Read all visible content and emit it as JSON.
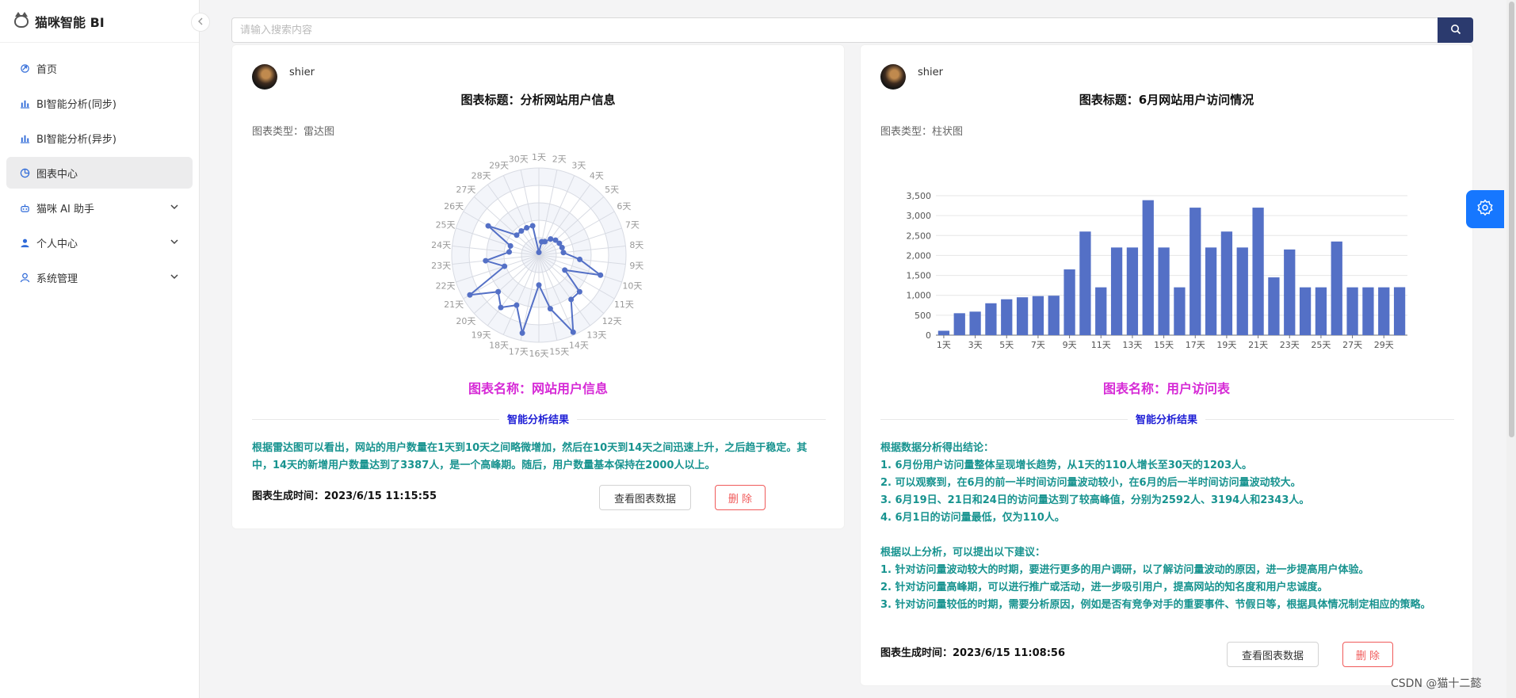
{
  "app": {
    "title": "猫咪智能 BI",
    "collapse_icon": "chevron-left-icon"
  },
  "sidebar": {
    "items": [
      {
        "label": "首页",
        "icon": "home-icon",
        "active": false,
        "has_children": false
      },
      {
        "label": "BI智能分析(同步)",
        "icon": "bar-chart-icon",
        "active": false,
        "has_children": false
      },
      {
        "label": "BI智能分析(异步)",
        "icon": "bar-chart-icon",
        "active": false,
        "has_children": false
      },
      {
        "label": "图表中心",
        "icon": "pie-chart-icon",
        "active": true,
        "has_children": false
      },
      {
        "label": "猫咪 AI 助手",
        "icon": "robot-icon",
        "active": false,
        "has_children": true
      },
      {
        "label": "个人中心",
        "icon": "user-icon",
        "active": false,
        "has_children": true
      },
      {
        "label": "系统管理",
        "icon": "team-icon",
        "active": false,
        "has_children": true
      }
    ]
  },
  "search": {
    "placeholder": "请输入搜索内容",
    "value": "",
    "button_icon": "search-icon"
  },
  "cards": [
    {
      "user": "shier",
      "title": "图表标题：分析网站用户信息",
      "type": "图表类型：雷达图",
      "name": "图表名称：网站用户信息",
      "divider_label": "智能分析结果",
      "analysis": [
        "根据雷达图可以看出，网站的用户数量在1天到10天之间略微增加，然后在10天到14天之间迅速上升，之后趋于稳定。其中，14天的新增用户数量达到了3387人，是一个高峰期。随后，用户数量基本保持在2000人以上。"
      ],
      "gen_time": "图表生成时间：2023/6/15 11:15:55",
      "view_label": "查看图表数据",
      "delete_label": "删 除"
    },
    {
      "user": "shier",
      "title": "图表标题：6月网站用户访问情况",
      "type": "图表类型：柱状图",
      "name": "图表名称：用户访问表",
      "divider_label": "智能分析结果",
      "analysis": [
        "根据数据分析得出结论：",
        "1. 6月份用户访问量整体呈现增长趋势，从1天的110人增长至30天的1203人。",
        "2. 可以观察到，在6月的前一半时间访问量波动较小，在6月的后一半时间访问量波动较大。",
        "3. 6月19日、21日和24日的访问量达到了较高峰值，分别为2592人、3194人和2343人。",
        "4. 6月1日的访问量最低，仅为110人。",
        "",
        "根据以上分析，可以提出以下建议：",
        "1. 针对访问量波动较大的时期，要进行更多的用户调研，以了解访问量波动的原因，进一步提高用户体验。",
        "2. 针对访问量高峰期，可以进行推广或活动，进一步吸引用户，提高网站的知名度和用户忠诚度。",
        "3. 针对访问量较低的时期，需要分析原因，例如是否有竞争对手的重要事件、节假日等，根据具体情况制定相应的策略。"
      ],
      "gen_time": "图表生成时间：2023/6/15 11:08:56",
      "view_label": "查看图表数据",
      "delete_label": "删 除"
    }
  ],
  "chart_data": [
    {
      "type": "radar",
      "categories": [
        "1天",
        "2天",
        "3天",
        "4天",
        "5天",
        "6天",
        "7天",
        "8天",
        "9天",
        "10天",
        "11天",
        "12天",
        "13天",
        "14天",
        "15天",
        "16天",
        "17天",
        "18天",
        "19天",
        "20天",
        "21天",
        "22天",
        "23天",
        "24天",
        "25天",
        "26天",
        "27天",
        "28天",
        "29天",
        "30天"
      ],
      "values": [
        110,
        550,
        590,
        800,
        900,
        950,
        980,
        990,
        1650,
        2600,
        1200,
        2200,
        2200,
        3387,
        2200,
        1200,
        3200,
        2200,
        2600,
        2200,
        3200,
        1450,
        2150,
        1200,
        1200,
        2350,
        1200,
        1200,
        1200,
        1203
      ],
      "max": 3500,
      "color": "#5470c6"
    },
    {
      "type": "bar",
      "categories": [
        "1天",
        "2天",
        "3天",
        "4天",
        "5天",
        "6天",
        "7天",
        "8天",
        "9天",
        "10天",
        "11天",
        "12天",
        "13天",
        "14天",
        "15天",
        "16天",
        "17天",
        "18天",
        "19天",
        "20天",
        "21天",
        "22天",
        "23天",
        "24天",
        "25天",
        "26天",
        "27天",
        "28天",
        "29天",
        "30天"
      ],
      "x_tick_labels": [
        "1天",
        "3天",
        "5天",
        "7天",
        "9天",
        "11天",
        "13天",
        "15天",
        "17天",
        "19天",
        "21天",
        "23天",
        "25天",
        "27天",
        "29天"
      ],
      "values": [
        110,
        550,
        590,
        800,
        900,
        950,
        980,
        990,
        1650,
        2600,
        1200,
        2200,
        2200,
        3387,
        2200,
        1200,
        3200,
        2200,
        2600,
        2200,
        3200,
        1450,
        2150,
        1200,
        1200,
        2350,
        1200,
        1200,
        1200,
        1203
      ],
      "ylim": [
        0,
        3500
      ],
      "y_ticks": [
        "0",
        "500",
        "1,000",
        "1,500",
        "2,000",
        "2,500",
        "3,000",
        "3,500"
      ],
      "grid": true,
      "color": "#5470c6"
    }
  ],
  "settings": {
    "icon": "gear-icon"
  },
  "watermark": "CSDN @猫十二懿",
  "colors": {
    "accent": "#2b3a6e",
    "primary": "#1677ff",
    "chart": "#5470c6",
    "name": "#d62ad6",
    "analysis": "#17938f",
    "danger": "#f05a5a"
  }
}
